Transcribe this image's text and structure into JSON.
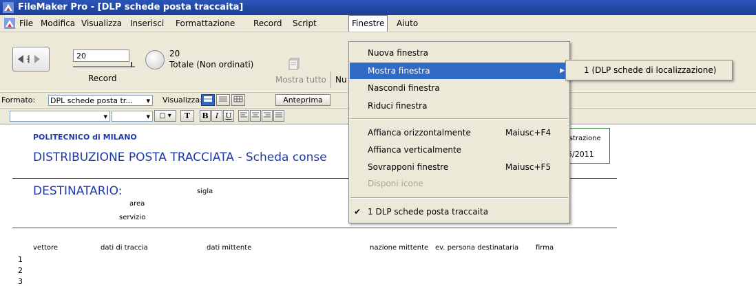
{
  "window": {
    "title": "FileMaker Pro - [DLP schede posta traccaita]"
  },
  "menubar": [
    "File",
    "Modifica",
    "Visualizza",
    "Inserisci",
    "Formattazione",
    "Record",
    "Script",
    "Finestre",
    "Aiuto"
  ],
  "status": {
    "record_value": "20",
    "record_label": "Record",
    "total_count": "20",
    "total_label": "Totale (Non ordinati)",
    "show_all": "Mostra tutto",
    "new_truncated": "Nu"
  },
  "formatbar": {
    "format_label": "Formato:",
    "format_value": "DPL schede posta tr...",
    "view_label": "Visualizza:",
    "preview": "Anteprima"
  },
  "textbar": {
    "bold": "B",
    "italic": "I",
    "underline": "U",
    "text_tool": "T"
  },
  "layout": {
    "institution": "POLITECNICO di MILANO",
    "heading": "DISTRIBUZIONE POSTA TRACCIATA - Scheda conse",
    "reg_label": "istrazione",
    "reg_date": "5/2011",
    "dest_label": "DESTINATARIO:",
    "sigla": "sigla",
    "area": "area",
    "servizio": "servizio",
    "columns": [
      "vettore",
      "dati di traccia",
      "dati mittente",
      "nazione mittente",
      "ev. persona destinataria",
      "firma"
    ],
    "rows": [
      "1",
      "2",
      "3"
    ]
  },
  "menu": {
    "items": [
      {
        "label": "Nuova finestra",
        "shortcut": ""
      },
      {
        "label": "Mostra finestra",
        "shortcut": ""
      },
      {
        "label": "Nascondi finestra",
        "shortcut": ""
      },
      {
        "label": "Riduci finestra",
        "shortcut": ""
      },
      {
        "label": "Affianca orizzontalmente",
        "shortcut": "Maiusc+F4"
      },
      {
        "label": "Affianca verticalmente",
        "shortcut": ""
      },
      {
        "label": "Sovrapponi finestre",
        "shortcut": "Maiusc+F5"
      },
      {
        "label": "Disponi icone",
        "shortcut": ""
      },
      {
        "label": "1 DLP schede posta traccaita",
        "shortcut": ""
      }
    ]
  },
  "submenu": {
    "item": "1 (DLP schede di localizzazione)"
  },
  "colors": {
    "title_bar": "#1c3f96",
    "highlight": "#316ac5",
    "chrome": "#ece9d8",
    "rule": "#3b3b8f",
    "heading_text": "#1f3aa8"
  }
}
